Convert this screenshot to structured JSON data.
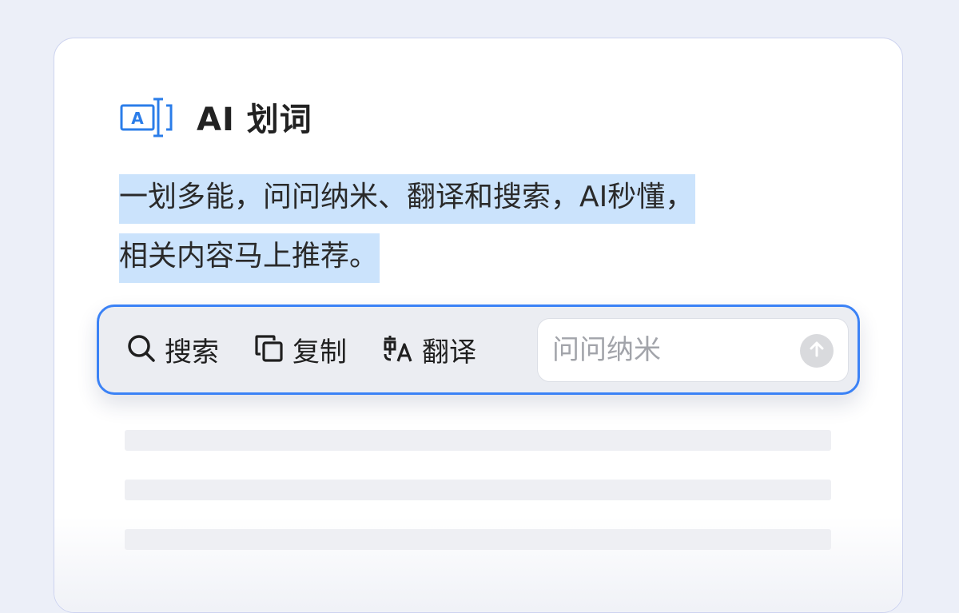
{
  "card": {
    "title": "AI 划词",
    "icon": "text-selection-icon",
    "description_line1": "一划多能，问问纳米、翻译和搜索，AI秒懂，",
    "description_line2": "相关内容马上推荐。"
  },
  "toolbar": {
    "search_label": "搜索",
    "search_icon": "search-icon",
    "copy_label": "复制",
    "copy_icon": "copy-icon",
    "translate_label": "翻译",
    "translate_icon": "translate-icon",
    "ask_placeholder": "问问纳米",
    "send_icon": "send-arrow-up-icon"
  },
  "colors": {
    "accent": "#3b82f6",
    "highlight": "#cbe3fc",
    "background": "#eceff8"
  }
}
